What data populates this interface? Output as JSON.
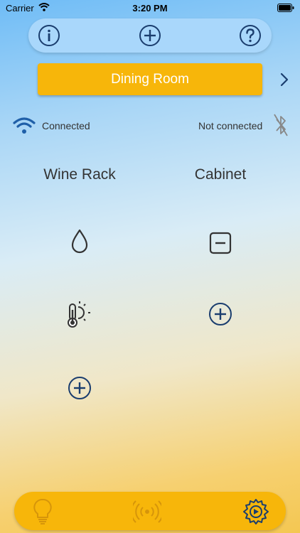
{
  "status": {
    "carrier": "Carrier",
    "time": "3:20 PM"
  },
  "toolbar": {
    "icons": [
      "info-icon",
      "add-circle-icon",
      "help-icon"
    ]
  },
  "room": {
    "name": "Dining Room"
  },
  "connection": {
    "wifi_status": "Connected",
    "bluetooth_status": "Not connected"
  },
  "columns": [
    {
      "title": "Wine Rack",
      "tiles": [
        "water-drop-icon",
        "thermometer-sun-icon",
        "add-circle-icon"
      ]
    },
    {
      "title": "Cabinet",
      "tiles": [
        "minus-square-icon",
        "add-circle-icon"
      ]
    }
  ],
  "tabbar": {
    "icons": [
      "lightbulb-icon",
      "wireless-signal-icon",
      "settings-gear-icon"
    ]
  },
  "colors": {
    "accent": "#f7b60a",
    "toolbar": "#a9d7fb",
    "icon_navy": "#1a3d6e",
    "wifi_blue": "#1f5fa8"
  }
}
